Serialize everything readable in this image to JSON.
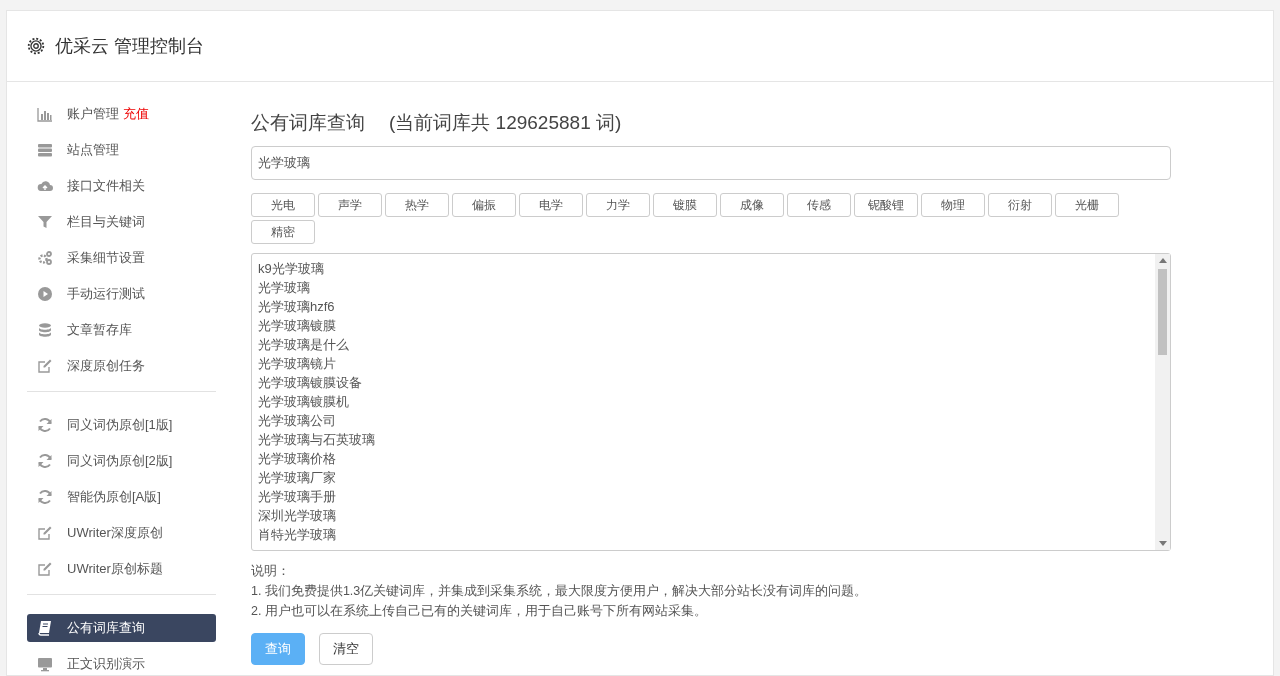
{
  "header": {
    "title": "优采云 管理控制台"
  },
  "sidebar": {
    "groups": [
      {
        "items": [
          {
            "label": "账户管理",
            "badge": "充值",
            "selected": false
          },
          {
            "label": "站点管理",
            "selected": false
          },
          {
            "label": "接口文件相关",
            "selected": false
          },
          {
            "label": "栏目与关键词",
            "selected": false
          },
          {
            "label": "采集细节设置",
            "selected": false
          },
          {
            "label": "手动运行测试",
            "selected": false
          },
          {
            "label": "文章暂存库",
            "selected": false
          },
          {
            "label": "深度原创任务",
            "selected": false
          }
        ]
      },
      {
        "items": [
          {
            "label": "同义词伪原创[1版]",
            "selected": false
          },
          {
            "label": "同义词伪原创[2版]",
            "selected": false
          },
          {
            "label": "智能伪原创[A版]",
            "selected": false
          },
          {
            "label": "UWriter深度原创",
            "selected": false
          },
          {
            "label": "UWriter原创标题",
            "selected": false
          }
        ]
      },
      {
        "items": [
          {
            "label": "公有词库查询",
            "selected": true
          },
          {
            "label": "正文识别演示",
            "selected": false
          }
        ]
      }
    ]
  },
  "main": {
    "title": "公有词库查询",
    "count_note": "(当前词库共 129625881 词)",
    "search": {
      "value": "光学玻璃"
    },
    "tags": [
      "光电",
      "声学",
      "热学",
      "偏振",
      "电学",
      "力学",
      "镀膜",
      "成像",
      "传感",
      "铌酸锂",
      "物理",
      "衍射",
      "光栅",
      "精密"
    ],
    "results": [
      "k9光学玻璃",
      "光学玻璃",
      "光学玻璃hzf6",
      "光学玻璃镀膜",
      "光学玻璃是什么",
      "光学玻璃镜片",
      "光学玻璃镀膜设备",
      "光学玻璃镀膜机",
      "光学玻璃公司",
      "光学玻璃与石英玻璃",
      "光学玻璃价格",
      "光学玻璃厂家",
      "光学玻璃手册",
      "深圳光学玻璃",
      "肖特光学玻璃"
    ],
    "notes_title": "说明：",
    "notes": [
      "1. 我们免费提供1.3亿关键词库，并集成到采集系统，最大限度方便用户，解决大部分站长没有词库的问题。",
      "2. 用户也可以在系统上传自己已有的关键词库，用于自己账号下所有网站采集。"
    ],
    "buttons": [
      {
        "label": "查询",
        "kind": "primary"
      },
      {
        "label": "清空",
        "kind": "default"
      }
    ]
  }
}
